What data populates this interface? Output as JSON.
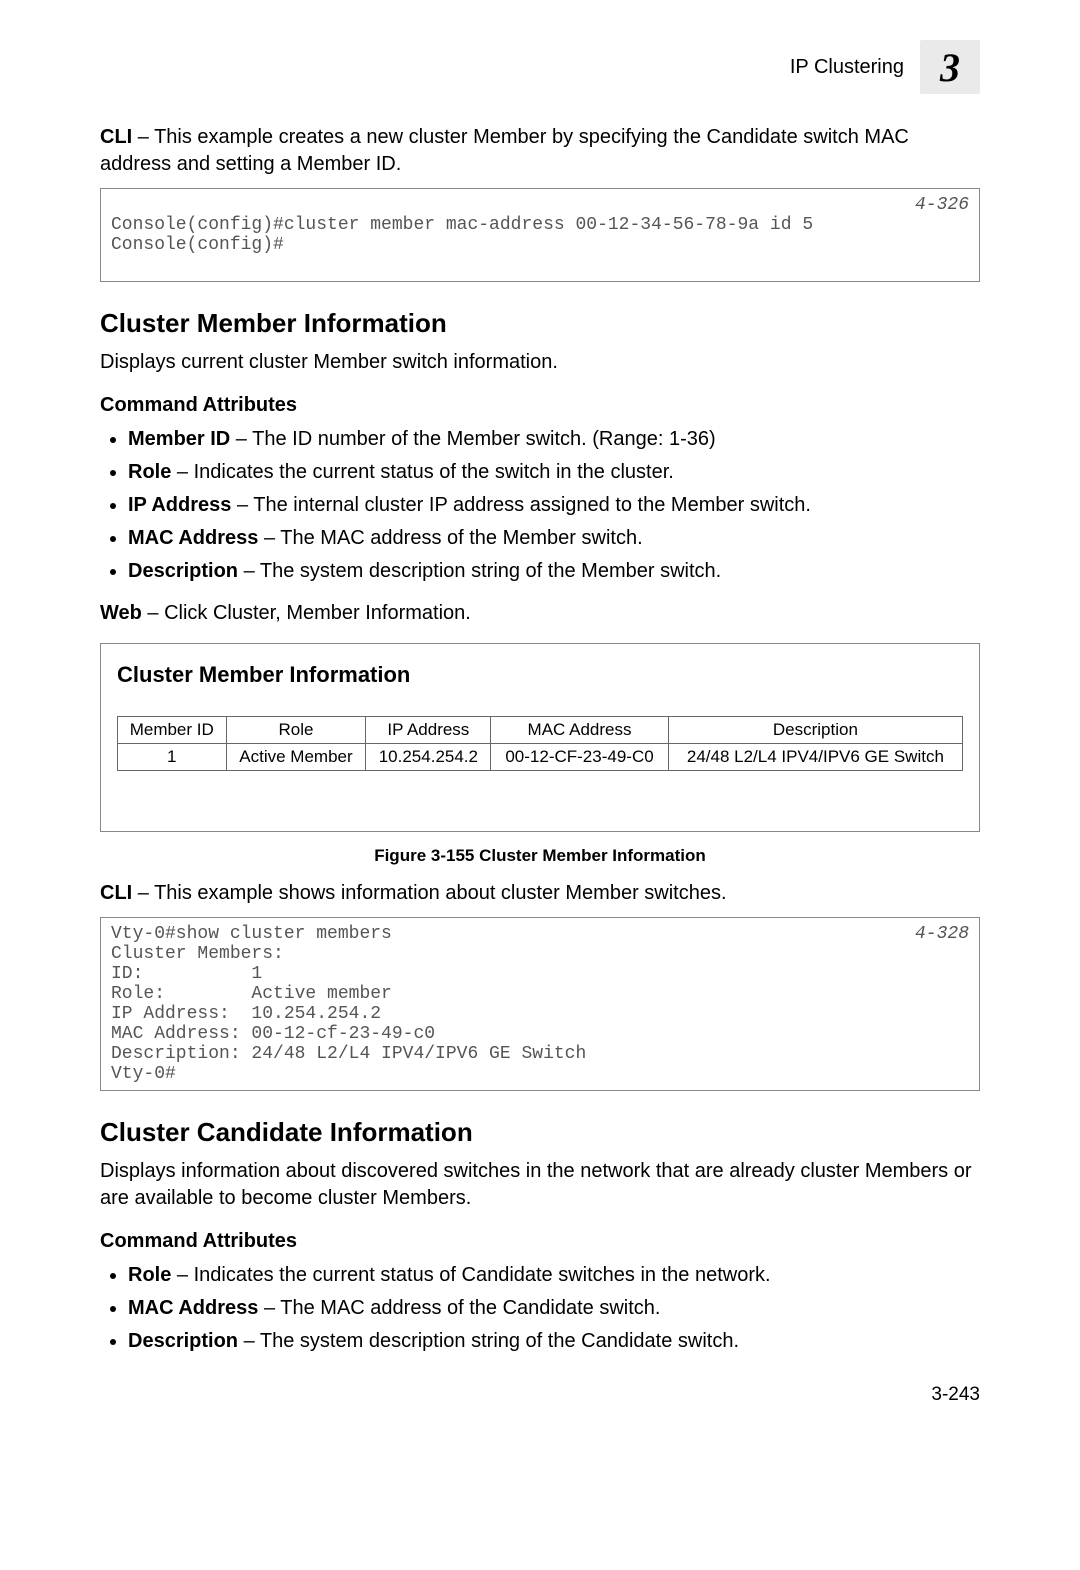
{
  "header": {
    "section_title": "IP Clustering",
    "chapter_number": "3"
  },
  "intro_cli_prefix": "CLI",
  "intro_cli_text": " – This example creates a new cluster Member by specifying the Candidate switch MAC address and setting a Member ID.",
  "code1": {
    "line1": "Console(config)#cluster member mac-address 00-12-34-56-78-9a id 5",
    "line2": "Console(config)#",
    "ref": "4-326"
  },
  "section_member": {
    "heading": "Cluster Member Information",
    "desc": "Displays current cluster Member switch information.",
    "attr_heading": "Command Attributes",
    "attrs": [
      {
        "label": "Member ID",
        "text": " – The ID number of the Member switch. (Range: 1-36)"
      },
      {
        "label": "Role",
        "text": " – Indicates the current status of the switch in the cluster."
      },
      {
        "label": "IP Address",
        "text": " – The internal cluster IP address assigned to the Member switch."
      },
      {
        "label": "MAC Address",
        "text": " – The MAC address of the Member switch."
      },
      {
        "label": "Description",
        "text": " – The system description string of the Member switch."
      }
    ],
    "web_prefix": "Web",
    "web_text": " – Click Cluster, Member Information.",
    "screenshot": {
      "title": "Cluster Member Information",
      "headers": [
        "Member ID",
        "Role",
        "IP Address",
        "MAC Address",
        "Description"
      ],
      "row": [
        "1",
        "Active Member",
        "10.254.254.2",
        "00-12-CF-23-49-C0",
        "24/48 L2/L4 IPV4/IPV6 GE Switch"
      ]
    },
    "figure_caption": "Figure 3-155  Cluster Member Information",
    "cli2_prefix": "CLI",
    "cli2_text": " – This example shows information about cluster Member switches."
  },
  "code2": {
    "ref": "4-328",
    "lines": "Vty-0#show cluster members\nCluster Members:\nID:          1\nRole:        Active member\nIP Address:  10.254.254.2\nMAC Address: 00-12-cf-23-49-c0\nDescription: 24/48 L2/L4 IPV4/IPV6 GE Switch\nVty-0#"
  },
  "section_candidate": {
    "heading": "Cluster Candidate Information",
    "desc": "Displays information about discovered switches in the network that are already cluster Members or are available to become cluster Members.",
    "attr_heading": "Command Attributes",
    "attrs": [
      {
        "label": "Role",
        "text": " – Indicates the current status of Candidate switches in the network."
      },
      {
        "label": "MAC Address",
        "text": " – The MAC address of the Candidate switch."
      },
      {
        "label": "Description",
        "text": " – The system description string of the Candidate switch."
      }
    ]
  },
  "page_number": "3-243",
  "chart_data": {
    "type": "table",
    "title": "Cluster Member Information",
    "columns": [
      "Member ID",
      "Role",
      "IP Address",
      "MAC Address",
      "Description"
    ],
    "rows": [
      [
        "1",
        "Active Member",
        "10.254.254.2",
        "00-12-CF-23-49-C0",
        "24/48 L2/L4 IPV4/IPV6 GE Switch"
      ]
    ]
  }
}
